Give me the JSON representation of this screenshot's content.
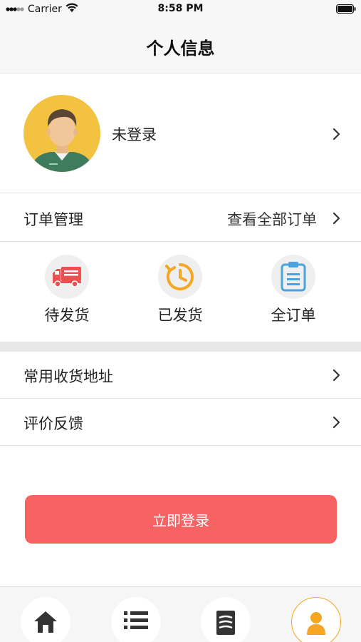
{
  "status_bar": {
    "carrier": "Carrier",
    "time": "8:58 PM"
  },
  "nav": {
    "title": "个人信息"
  },
  "profile": {
    "name": "未登录",
    "avatar_icon": "user-avatar-icon"
  },
  "orders": {
    "title": "订单管理",
    "view_all": "查看全部订单",
    "items": [
      {
        "label": "待发货",
        "icon": "truck-icon",
        "color": "#e9504f"
      },
      {
        "label": "已发货",
        "icon": "clock-icon",
        "color": "#f5a623"
      },
      {
        "label": "全订单",
        "icon": "clipboard-icon",
        "color": "#4aa3df"
      }
    ]
  },
  "menu": {
    "items": [
      {
        "label": "常用收货地址"
      },
      {
        "label": "评价反馈"
      }
    ]
  },
  "login_button": {
    "label": "立即登录",
    "color": "#f76363"
  },
  "tab_bar": {
    "tabs": [
      {
        "icon": "home-icon",
        "active": false
      },
      {
        "icon": "list-icon",
        "active": false
      },
      {
        "icon": "document-icon",
        "active": false
      },
      {
        "icon": "person-icon",
        "active": true,
        "color": "#f5a623"
      }
    ]
  }
}
